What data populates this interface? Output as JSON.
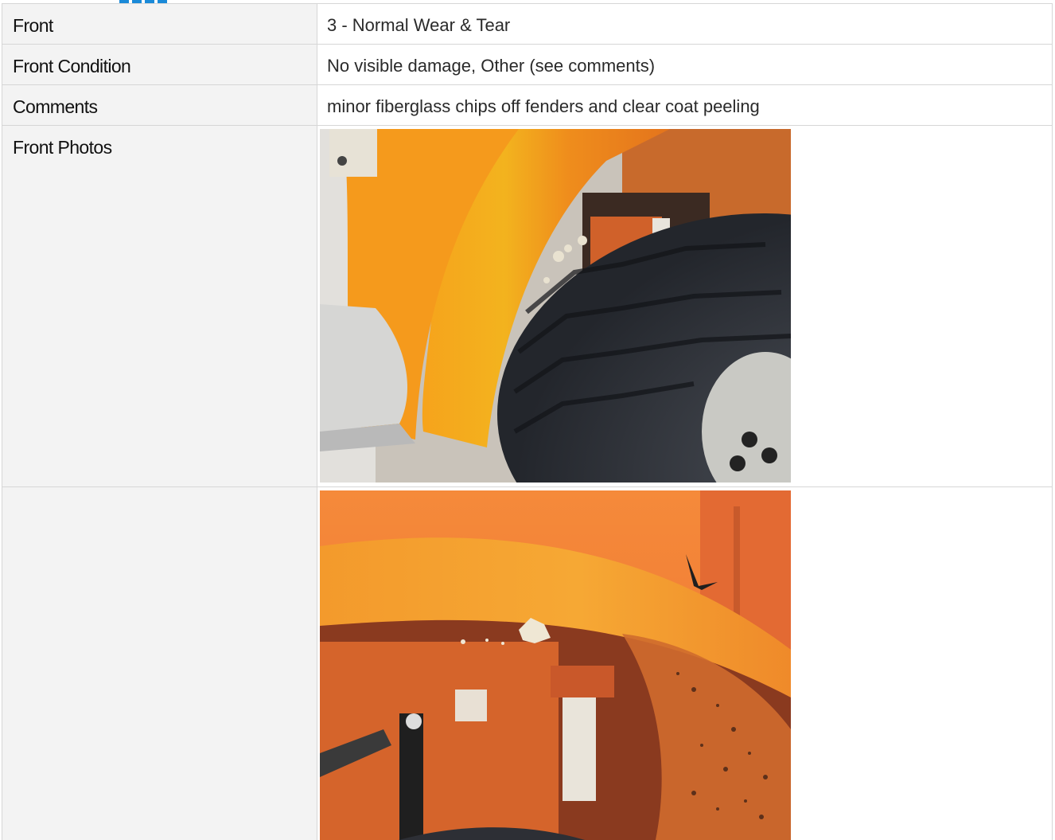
{
  "rows": [
    {
      "label": "Front",
      "value": "3 - Normal Wear & Tear"
    },
    {
      "label": "Front Condition",
      "value": "No visible damage, Other (see comments)"
    },
    {
      "label": "Comments",
      "value": "minor fiberglass chips off fenders and clear coat peeling"
    }
  ],
  "photos": {
    "label": "Front Photos",
    "items": [
      {
        "subject": "orange fender above truck tire with wheel lugs"
      },
      {
        "subject": "orange fender arch with chipped paint over chassis"
      }
    ]
  },
  "colors": {
    "label_bg": "#f3f3f3",
    "border": "#d6d6d6",
    "heading_accent": "#1a8ad8",
    "fender_orange": "#f08a1c"
  }
}
